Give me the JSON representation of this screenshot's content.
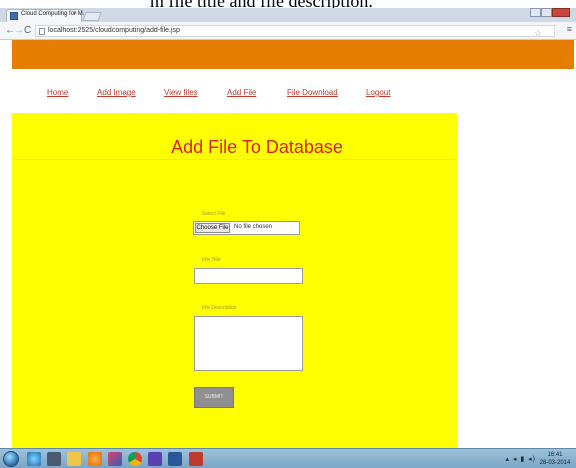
{
  "document_caption": "m file title and file description.",
  "browser": {
    "tab_title": "Cloud Computing for M...",
    "tab_close": "×",
    "url": "localhost:2525/cloudcomputing/add-file.jsp",
    "nav_back": "←",
    "nav_forward": "→",
    "nav_reload": "C",
    "star": "☆",
    "menu": "≡"
  },
  "site_nav": {
    "items": [
      {
        "label": "Home"
      },
      {
        "label": "Add Image"
      },
      {
        "label": "View files"
      },
      {
        "label": "Add File"
      },
      {
        "label": "File Download"
      },
      {
        "label": "Logout"
      }
    ]
  },
  "form": {
    "title": "Add File To Database",
    "select_file_label": "Select File",
    "choose_file_button": "Choose File",
    "file_status": "No file chosen",
    "file_title_label": "File Title",
    "file_title_value": "",
    "file_description_label": "File Description",
    "file_description_value": "",
    "submit_label": "SUBMIT"
  },
  "taskbar": {
    "tray_icons": "▴ ◂ ▮ ◂)",
    "clock_time": "16:41",
    "clock_date": "28-03-2014"
  },
  "colors": {
    "header_bar": "#e57e00",
    "panel": "#ffff00",
    "title": "#dd2020",
    "nav_link": "#c0392b"
  }
}
